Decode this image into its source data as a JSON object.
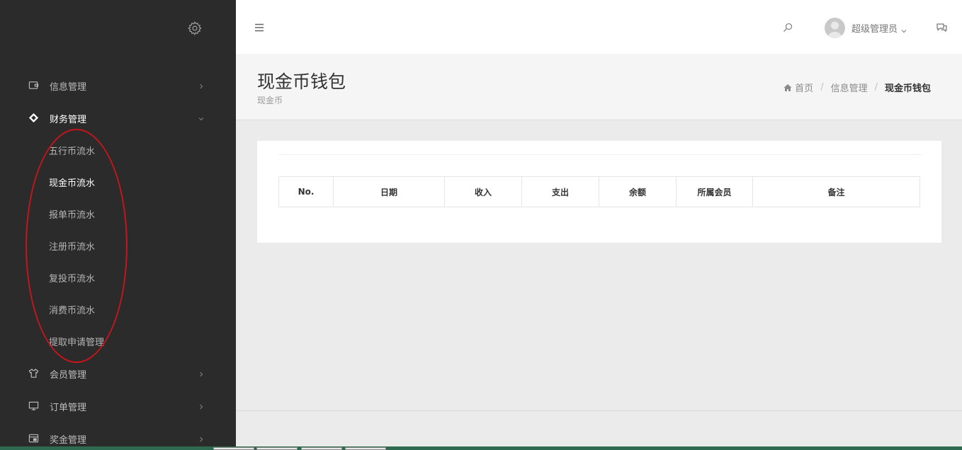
{
  "sidebar": {
    "menu": [
      {
        "label": "信息管理",
        "icon": "wallet-icon",
        "expanded": false
      },
      {
        "label": "财务管理",
        "icon": "diamond-tag-icon",
        "expanded": true
      }
    ],
    "finance_submenu": [
      {
        "label": "五行币流水"
      },
      {
        "label": "现金币流水",
        "current": true
      },
      {
        "label": "报单币流水"
      },
      {
        "label": "注册币流水"
      },
      {
        "label": "复投币流水"
      },
      {
        "label": "消费币流水"
      },
      {
        "label": "提取申请管理"
      }
    ],
    "menu_after": [
      {
        "label": "会员管理",
        "icon": "shirt-icon"
      },
      {
        "label": "订单管理",
        "icon": "monitor-icon"
      },
      {
        "label": "奖金管理",
        "icon": "wallet-card-icon"
      }
    ],
    "annotation_color": "#c4161c"
  },
  "topbar": {
    "user_name": "超级管理员"
  },
  "page": {
    "title": "现金币钱包",
    "subtitle": "现金币",
    "breadcrumb": {
      "home": "首页",
      "parent": "信息管理",
      "current": "现金币钱包"
    }
  },
  "table": {
    "columns": [
      "No.",
      "日期",
      "收入",
      "支出",
      "余额",
      "所属会员",
      "备注"
    ]
  }
}
